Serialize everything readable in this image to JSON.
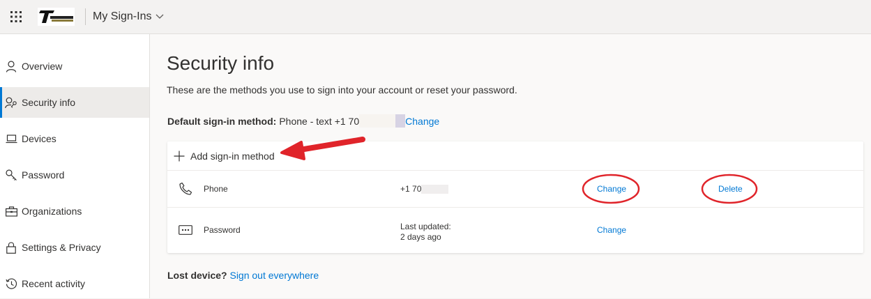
{
  "header": {
    "app_title": "My Sign-Ins"
  },
  "sidebar": {
    "items": [
      {
        "label": "Overview",
        "icon": "person-icon"
      },
      {
        "label": "Security info",
        "icon": "person-key-icon",
        "active": true
      },
      {
        "label": "Devices",
        "icon": "laptop-icon"
      },
      {
        "label": "Password",
        "icon": "key-icon"
      },
      {
        "label": "Organizations",
        "icon": "briefcase-icon"
      },
      {
        "label": "Settings & Privacy",
        "icon": "lock-icon"
      },
      {
        "label": "Recent activity",
        "icon": "history-icon"
      }
    ]
  },
  "main": {
    "title": "Security info",
    "subtitle": "These are the methods you use to sign into your account or reset your password.",
    "default_method_label": "Default sign-in method:",
    "default_method_value": "Phone - text +1 70",
    "default_method_change": "Change",
    "add_method_label": "Add sign-in method",
    "methods": [
      {
        "name": "Phone",
        "detail": "+1 70",
        "change_label": "Change",
        "delete_label": "Delete",
        "icon": "phone-icon"
      },
      {
        "name": "Password",
        "detail_line1": "Last updated:",
        "detail_line2": "2 days ago",
        "change_label": "Change",
        "icon": "password-dots-icon"
      }
    ],
    "lost_device_label": "Lost device?",
    "sign_out_link": "Sign out everywhere"
  },
  "colors": {
    "accent": "#0078d4",
    "annotation": "#e0242a"
  }
}
